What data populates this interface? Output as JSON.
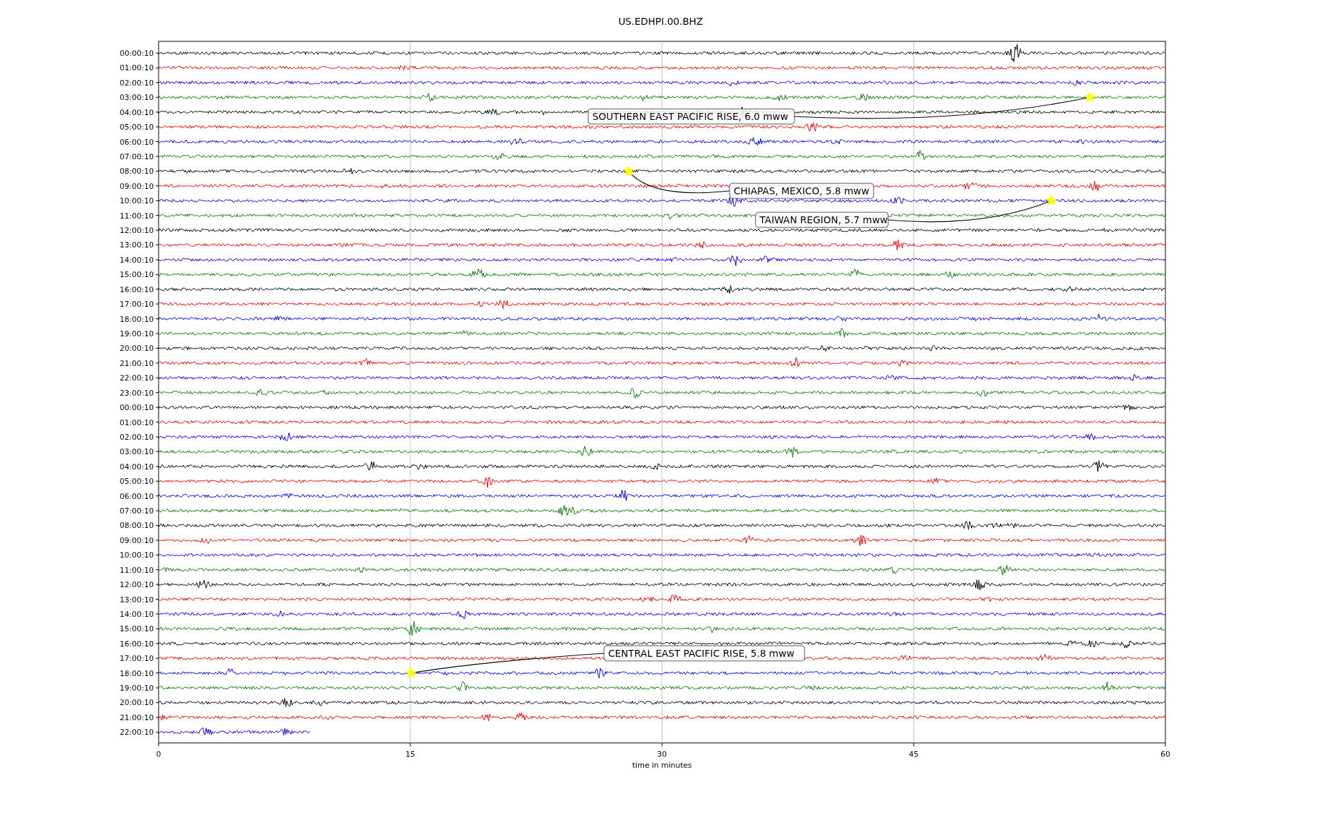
{
  "title": "US.EDHPI.00.BHZ",
  "xlabel": "time in minutes",
  "xticks": [
    "0",
    "15",
    "30",
    "45",
    "60"
  ],
  "rows": [
    {
      "label": "00:00:10",
      "color": "#000000",
      "complete": true
    },
    {
      "label": "01:00:10",
      "color": "#ff0000",
      "complete": true
    },
    {
      "label": "02:00:10",
      "color": "#0000ff",
      "complete": true
    },
    {
      "label": "03:00:10",
      "color": "#008000",
      "complete": true
    },
    {
      "label": "04:00:10",
      "color": "#000000",
      "complete": true
    },
    {
      "label": "05:00:10",
      "color": "#ff0000",
      "complete": true
    },
    {
      "label": "06:00:10",
      "color": "#0000ff",
      "complete": true
    },
    {
      "label": "07:00:10",
      "color": "#008000",
      "complete": true
    },
    {
      "label": "08:00:10",
      "color": "#000000",
      "complete": true
    },
    {
      "label": "09:00:10",
      "color": "#ff0000",
      "complete": true
    },
    {
      "label": "10:00:10",
      "color": "#0000ff",
      "complete": true
    },
    {
      "label": "11:00:10",
      "color": "#008000",
      "complete": true
    },
    {
      "label": "12:00:10",
      "color": "#000000",
      "complete": true
    },
    {
      "label": "13:00:10",
      "color": "#ff0000",
      "complete": true
    },
    {
      "label": "14:00:10",
      "color": "#0000ff",
      "complete": true
    },
    {
      "label": "15:00:10",
      "color": "#008000",
      "complete": true
    },
    {
      "label": "16:00:10",
      "color": "#000000",
      "complete": true
    },
    {
      "label": "17:00:10",
      "color": "#ff0000",
      "complete": true
    },
    {
      "label": "18:00:10",
      "color": "#0000ff",
      "complete": true
    },
    {
      "label": "19:00:10",
      "color": "#008000",
      "complete": true
    },
    {
      "label": "20:00:10",
      "color": "#000000",
      "complete": true
    },
    {
      "label": "21:00:10",
      "color": "#ff0000",
      "complete": true
    },
    {
      "label": "22:00:10",
      "color": "#0000ff",
      "complete": true
    },
    {
      "label": "23:00:10",
      "color": "#008000",
      "complete": true
    },
    {
      "label": "00:00:10",
      "color": "#000000",
      "complete": true
    },
    {
      "label": "01:00:10",
      "color": "#ff0000",
      "complete": true
    },
    {
      "label": "02:00:10",
      "color": "#0000ff",
      "complete": true
    },
    {
      "label": "03:00:10",
      "color": "#008000",
      "complete": true
    },
    {
      "label": "04:00:10",
      "color": "#000000",
      "complete": true
    },
    {
      "label": "05:00:10",
      "color": "#ff0000",
      "complete": true
    },
    {
      "label": "06:00:10",
      "color": "#0000ff",
      "complete": true
    },
    {
      "label": "07:00:10",
      "color": "#008000",
      "complete": true
    },
    {
      "label": "08:00:10",
      "color": "#000000",
      "complete": true
    },
    {
      "label": "09:00:10",
      "color": "#ff0000",
      "complete": true
    },
    {
      "label": "10:00:10",
      "color": "#0000ff",
      "complete": true
    },
    {
      "label": "11:00:10",
      "color": "#008000",
      "complete": true
    },
    {
      "label": "12:00:10",
      "color": "#000000",
      "complete": true
    },
    {
      "label": "13:00:10",
      "color": "#ff0000",
      "complete": true
    },
    {
      "label": "14:00:10",
      "color": "#0000ff",
      "complete": true
    },
    {
      "label": "15:00:10",
      "color": "#008000",
      "complete": true
    },
    {
      "label": "16:00:10",
      "color": "#000000",
      "complete": true
    },
    {
      "label": "17:00:10",
      "color": "#ff0000",
      "complete": true
    },
    {
      "label": "18:00:10",
      "color": "#0000ff",
      "complete": true
    },
    {
      "label": "19:00:10",
      "color": "#008000",
      "complete": true
    },
    {
      "label": "20:00:10",
      "color": "#000000",
      "complete": true
    },
    {
      "label": "21:00:10",
      "color": "#ff0000",
      "complete": true
    },
    {
      "label": "22:00:10",
      "color": "#0000ff",
      "complete": false
    }
  ],
  "events": [
    {
      "label": "SOUTHERN EAST PACIFIC RISE, 6.0 mww"
    },
    {
      "label": "CHIAPAS, MEXICO, 5.8 mww"
    },
    {
      "label": "TAIWAN REGION, 5.7 mww"
    },
    {
      "label": "CENTRAL EAST PACIFIC RISE, 5.8 mww"
    }
  ]
}
